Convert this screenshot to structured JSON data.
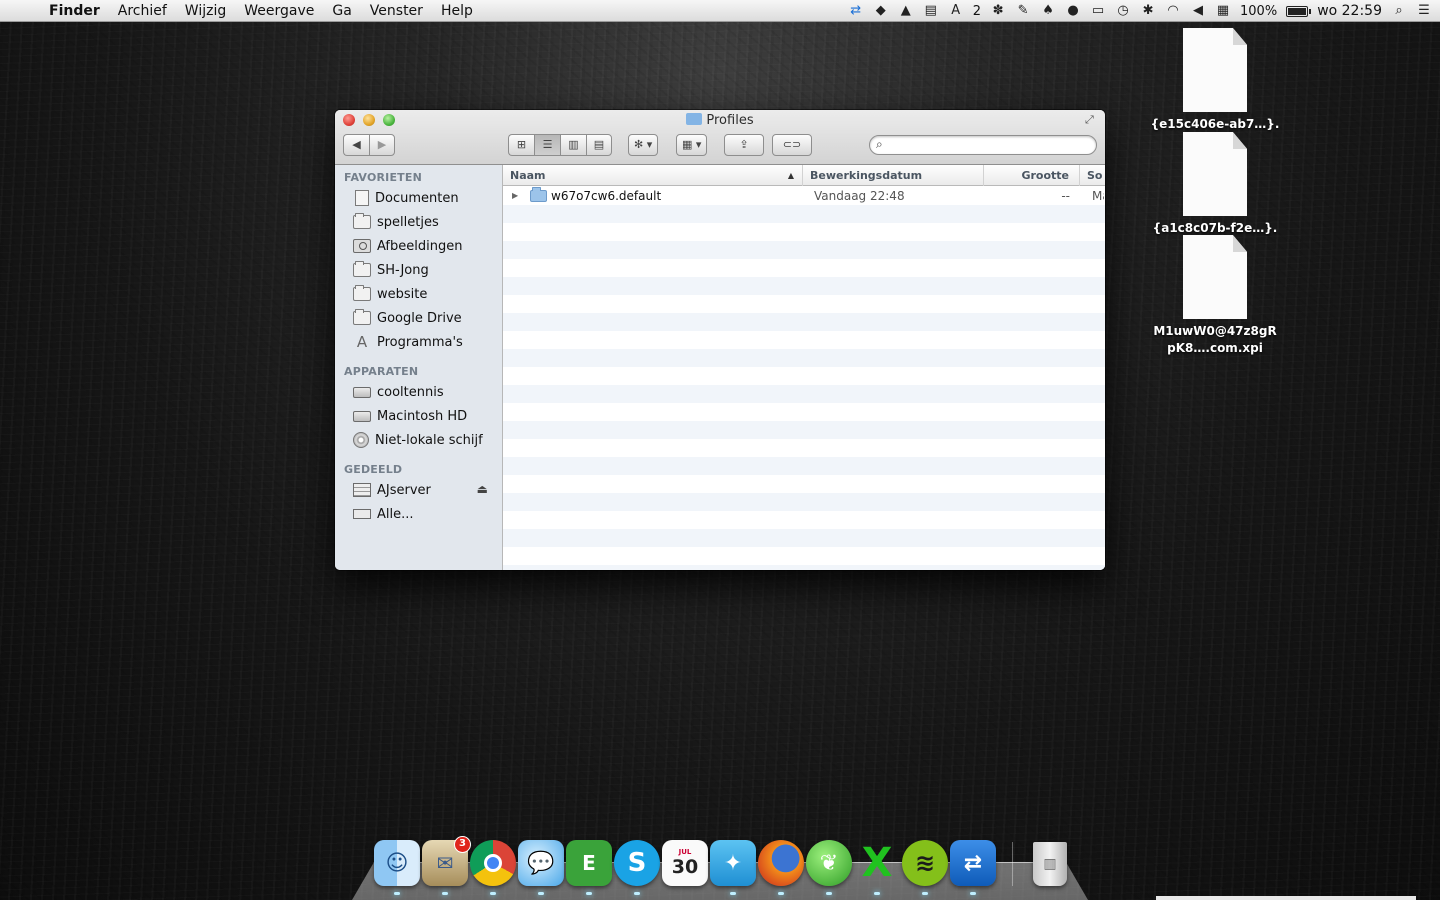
{
  "menubar": {
    "app_name": "Finder",
    "menus": [
      "Archief",
      "Wijzig",
      "Weergave",
      "Ga",
      "Venster",
      "Help"
    ],
    "status_right": {
      "adobe_count": "2",
      "battery_percent": "100%",
      "clock": "wo 22:59"
    }
  },
  "desktop_files": [
    {
      "label": "{e15c406e-ab7…}.xpi"
    },
    {
      "label": "{a1c8c07b-f2e…}.xpi"
    },
    {
      "label": "M1uwW0@47z8gRpK8….com.xpi"
    }
  ],
  "window": {
    "title": "Profiles",
    "sidebar": {
      "favorites_header": "FAVORIETEN",
      "favorites": [
        {
          "label": "Documenten",
          "icon": "document-icon"
        },
        {
          "label": "spelletjes",
          "icon": "folder-icon"
        },
        {
          "label": "Afbeeldingen",
          "icon": "camera-icon"
        },
        {
          "label": "SH-Jong",
          "icon": "folder-icon"
        },
        {
          "label": "website",
          "icon": "folder-icon"
        },
        {
          "label": "Google Drive",
          "icon": "folder-icon"
        },
        {
          "label": "Programma's",
          "icon": "applications-icon"
        }
      ],
      "devices_header": "APPARATEN",
      "devices": [
        {
          "label": "cooltennis",
          "icon": "laptop-icon"
        },
        {
          "label": "Macintosh HD",
          "icon": "hard-disk-icon"
        },
        {
          "label": "Niet-lokale schijf",
          "icon": "optical-disc-icon"
        }
      ],
      "shared_header": "GEDEELD",
      "shared": [
        {
          "label": "AJserver",
          "icon": "server-icon"
        },
        {
          "label": "Alle...",
          "icon": "network-icon"
        }
      ]
    },
    "columns": {
      "name": "Naam",
      "modified": "Bewerkingsdatum",
      "size": "Grootte",
      "kind": "So"
    },
    "rows": [
      {
        "name": "w67o7cw6.default",
        "modified": "Vandaag 22:48",
        "size": "--",
        "kind": "Map"
      }
    ],
    "search": {
      "placeholder": "",
      "value": ""
    }
  },
  "dock": {
    "mail_badge": "3",
    "calendar_month": "JUL",
    "calendar_day": "30",
    "apps": [
      "Finder",
      "Mail",
      "Google Chrome",
      "Berichten",
      "Evernote",
      "Skype",
      "Agenda",
      "Twitter",
      "Firefox",
      "Leaf",
      "Excel",
      "Spotify",
      "TeamViewer",
      "Prullenmand"
    ]
  },
  "colors": {
    "sidebar_bg": "#e2e7ed",
    "sidebar_header": "#75808c",
    "row_stripe": "#f1f5fa",
    "close": "#e0443b",
    "minimize": "#e3a52a",
    "zoom": "#4cb640"
  }
}
